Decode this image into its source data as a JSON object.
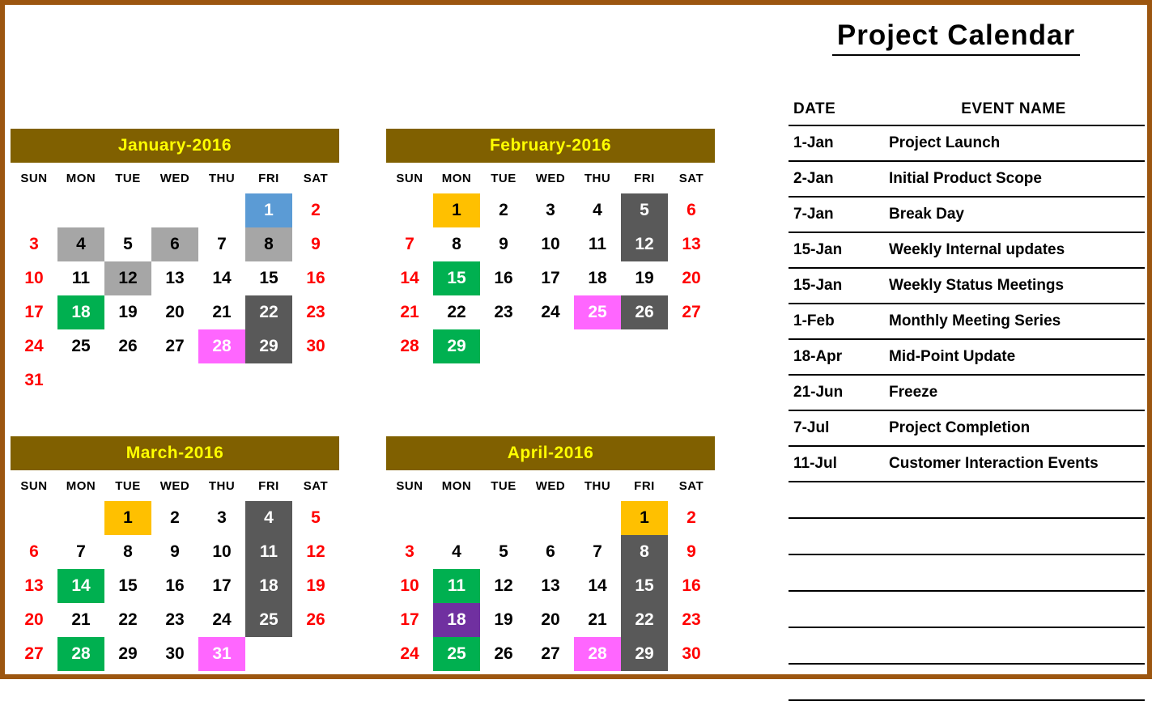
{
  "title": "Project Calendar",
  "weekdays": [
    "SUN",
    "MON",
    "TUE",
    "WED",
    "THU",
    "FRI",
    "SAT"
  ],
  "palette": {
    "page_border": "#9C5610",
    "month_header_bg": "#806000",
    "month_header_text": "#FFFF00",
    "weekend_text": "#FF0000",
    "weekday_text": "#000000",
    "blue": "#5B9BD5",
    "gray": "#A6A6A6",
    "dark_gray": "#595959",
    "green": "#00B050",
    "magenta": "#FF66FF",
    "orange": "#FFC000",
    "purple": "#7030A0"
  },
  "months": [
    {
      "title": "January-2016",
      "weeks": [
        [
          null,
          null,
          null,
          null,
          null,
          {
            "d": "1",
            "fill": "blue"
          },
          {
            "d": "2"
          }
        ],
        [
          {
            "d": "3"
          },
          {
            "d": "4",
            "fill": "gray"
          },
          {
            "d": "5"
          },
          {
            "d": "6",
            "fill": "gray"
          },
          {
            "d": "7"
          },
          {
            "d": "8",
            "fill": "gray"
          },
          {
            "d": "9"
          }
        ],
        [
          {
            "d": "10"
          },
          {
            "d": "11"
          },
          {
            "d": "12",
            "fill": "gray"
          },
          {
            "d": "13"
          },
          {
            "d": "14"
          },
          {
            "d": "15"
          },
          {
            "d": "16"
          }
        ],
        [
          {
            "d": "17"
          },
          {
            "d": "18",
            "fill": "green"
          },
          {
            "d": "19"
          },
          {
            "d": "20"
          },
          {
            "d": "21"
          },
          {
            "d": "22",
            "fill": "dgray"
          },
          {
            "d": "23"
          }
        ],
        [
          {
            "d": "24"
          },
          {
            "d": "25"
          },
          {
            "d": "26"
          },
          {
            "d": "27"
          },
          {
            "d": "28",
            "fill": "magenta"
          },
          {
            "d": "29",
            "fill": "dgray"
          },
          {
            "d": "30"
          }
        ],
        [
          {
            "d": "31"
          },
          null,
          null,
          null,
          null,
          null,
          null
        ]
      ]
    },
    {
      "title": "February-2016",
      "weeks": [
        [
          null,
          {
            "d": "1",
            "fill": "orange"
          },
          {
            "d": "2"
          },
          {
            "d": "3"
          },
          {
            "d": "4"
          },
          {
            "d": "5",
            "fill": "dgray"
          },
          {
            "d": "6"
          }
        ],
        [
          {
            "d": "7"
          },
          {
            "d": "8"
          },
          {
            "d": "9"
          },
          {
            "d": "10"
          },
          {
            "d": "11"
          },
          {
            "d": "12",
            "fill": "dgray"
          },
          {
            "d": "13"
          }
        ],
        [
          {
            "d": "14"
          },
          {
            "d": "15",
            "fill": "green"
          },
          {
            "d": "16"
          },
          {
            "d": "17"
          },
          {
            "d": "18"
          },
          {
            "d": "19"
          },
          {
            "d": "20"
          }
        ],
        [
          {
            "d": "21"
          },
          {
            "d": "22"
          },
          {
            "d": "23"
          },
          {
            "d": "24"
          },
          {
            "d": "25",
            "fill": "magenta"
          },
          {
            "d": "26",
            "fill": "dgray"
          },
          {
            "d": "27"
          }
        ],
        [
          {
            "d": "28"
          },
          {
            "d": "29",
            "fill": "green"
          },
          null,
          null,
          null,
          null,
          null
        ],
        [
          null,
          null,
          null,
          null,
          null,
          null,
          null
        ]
      ]
    },
    {
      "title": "March-2016",
      "weeks": [
        [
          null,
          null,
          {
            "d": "1",
            "fill": "orange"
          },
          {
            "d": "2"
          },
          {
            "d": "3"
          },
          {
            "d": "4",
            "fill": "dgray"
          },
          {
            "d": "5"
          }
        ],
        [
          {
            "d": "6"
          },
          {
            "d": "7"
          },
          {
            "d": "8"
          },
          {
            "d": "9"
          },
          {
            "d": "10"
          },
          {
            "d": "11",
            "fill": "dgray"
          },
          {
            "d": "12"
          }
        ],
        [
          {
            "d": "13"
          },
          {
            "d": "14",
            "fill": "green"
          },
          {
            "d": "15"
          },
          {
            "d": "16"
          },
          {
            "d": "17"
          },
          {
            "d": "18",
            "fill": "dgray"
          },
          {
            "d": "19"
          }
        ],
        [
          {
            "d": "20"
          },
          {
            "d": "21"
          },
          {
            "d": "22"
          },
          {
            "d": "23"
          },
          {
            "d": "24"
          },
          {
            "d": "25",
            "fill": "dgray"
          },
          {
            "d": "26"
          }
        ],
        [
          {
            "d": "27"
          },
          {
            "d": "28",
            "fill": "green"
          },
          {
            "d": "29"
          },
          {
            "d": "30"
          },
          {
            "d": "31",
            "fill": "magenta"
          },
          null,
          null
        ]
      ]
    },
    {
      "title": "April-2016",
      "weeks": [
        [
          null,
          null,
          null,
          null,
          null,
          {
            "d": "1",
            "fill": "orange"
          },
          {
            "d": "2"
          }
        ],
        [
          {
            "d": "3"
          },
          {
            "d": "4"
          },
          {
            "d": "5"
          },
          {
            "d": "6"
          },
          {
            "d": "7"
          },
          {
            "d": "8",
            "fill": "dgray"
          },
          {
            "d": "9"
          }
        ],
        [
          {
            "d": "10"
          },
          {
            "d": "11",
            "fill": "green"
          },
          {
            "d": "12"
          },
          {
            "d": "13"
          },
          {
            "d": "14"
          },
          {
            "d": "15",
            "fill": "dgray"
          },
          {
            "d": "16"
          }
        ],
        [
          {
            "d": "17"
          },
          {
            "d": "18",
            "fill": "purple"
          },
          {
            "d": "19"
          },
          {
            "d": "20"
          },
          {
            "d": "21"
          },
          {
            "d": "22",
            "fill": "dgray"
          },
          {
            "d": "23"
          }
        ],
        [
          {
            "d": "24"
          },
          {
            "d": "25",
            "fill": "green"
          },
          {
            "d": "26"
          },
          {
            "d": "27"
          },
          {
            "d": "28",
            "fill": "magenta"
          },
          {
            "d": "29",
            "fill": "dgray"
          },
          {
            "d": "30"
          }
        ]
      ]
    }
  ],
  "events": {
    "columns": [
      "DATE",
      "EVENT NAME"
    ],
    "rows": [
      {
        "date": "1-Jan",
        "name": "Project Launch"
      },
      {
        "date": "2-Jan",
        "name": "Initial Product Scope"
      },
      {
        "date": "7-Jan",
        "name": "Break Day"
      },
      {
        "date": "15-Jan",
        "name": "Weekly Internal updates"
      },
      {
        "date": "15-Jan",
        "name": "Weekly Status Meetings"
      },
      {
        "date": "1-Feb",
        "name": "Monthly Meeting Series"
      },
      {
        "date": "18-Apr",
        "name": "Mid-Point Update"
      },
      {
        "date": "21-Jun",
        "name": "Freeze"
      },
      {
        "date": "7-Jul",
        "name": "Project Completion"
      },
      {
        "date": "11-Jul",
        "name": "Customer Interaction Events"
      }
    ],
    "blank_rows": 6
  }
}
